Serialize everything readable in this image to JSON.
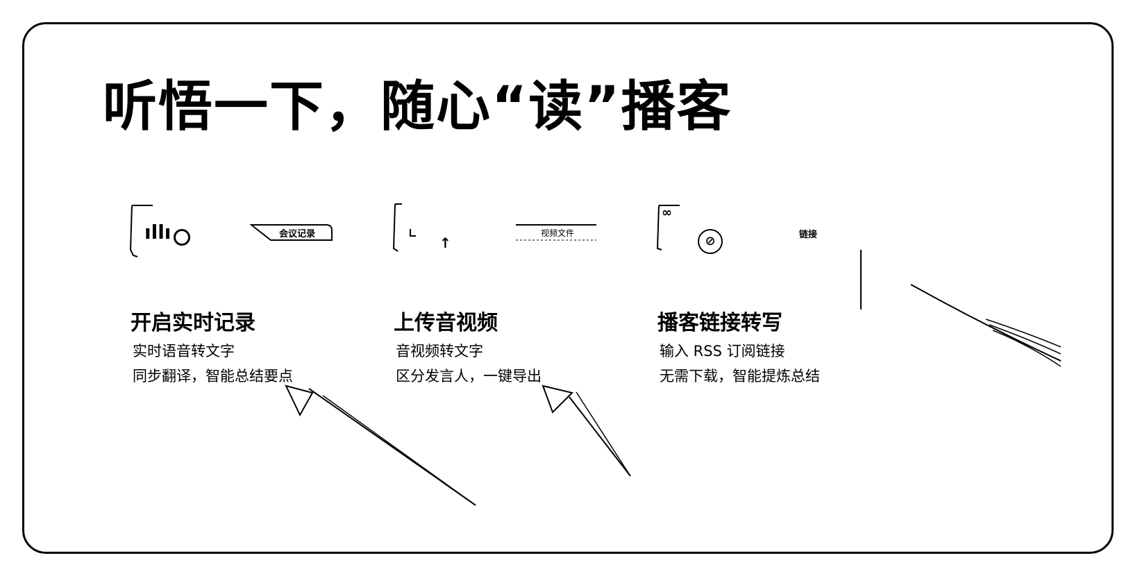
{
  "title": "听悟一下，随心“读”播客",
  "features": [
    {
      "tag": "会议记录",
      "title": "开启实时记录",
      "desc1": "实时语音转文字",
      "desc2": "同步翻译，智能总结要点",
      "icon": "waveform-mic-icon"
    },
    {
      "tag": "视频文件",
      "title": "上传音视频",
      "desc1": "音视频转文字",
      "desc2": "区分发言人，一键导出",
      "icon": "upload-icon"
    },
    {
      "tag": "链接",
      "title": "播客链接转写",
      "desc1": "输入 RSS 订阅链接",
      "desc2": "无需下载，智能提炼总结",
      "icon": "link-icon"
    }
  ]
}
